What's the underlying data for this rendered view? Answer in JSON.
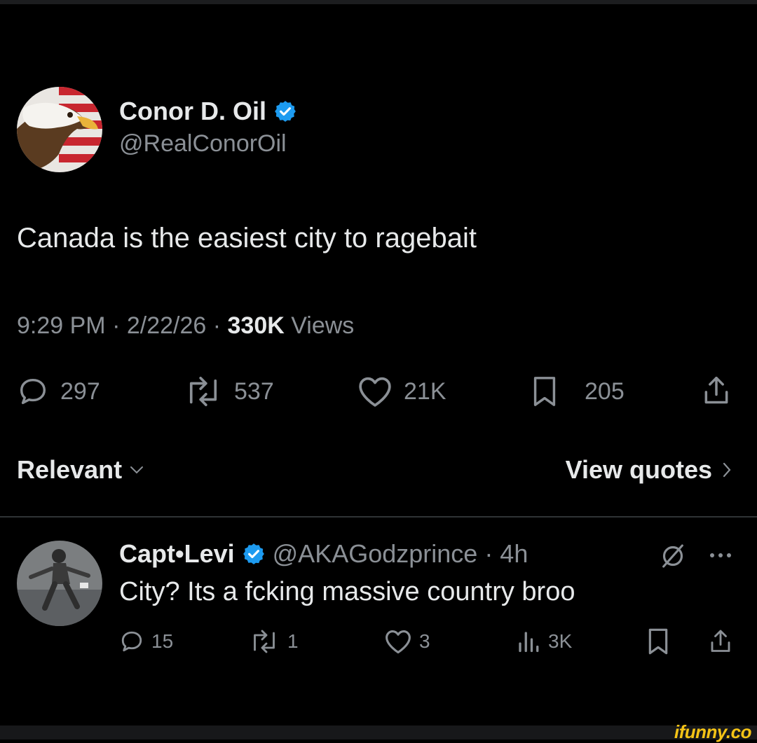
{
  "tweet": {
    "author": {
      "name": "Conor D. Oil",
      "handle": "@RealConorOil",
      "avatar_icon": "bald-eagle-flag-avatar"
    },
    "text": "Canada is the easiest city to ragebait",
    "time": "9:29 PM · 2/22/26 · ",
    "views_count": "330K",
    "views_label": " Views",
    "stats": {
      "replies": "297",
      "reposts": "537",
      "likes": "21K",
      "bookmarks": "205"
    }
  },
  "replies_bar": {
    "sort_label": "Relevant",
    "quotes_label": "View quotes"
  },
  "reply": {
    "name": "Capt•Levi",
    "handle": "@AKAGodzprince · 4h",
    "text": "City? Its a fcking massive country broo",
    "stats": {
      "replies": "15",
      "reposts": "1",
      "likes": "3",
      "views": "3K"
    }
  },
  "watermark": "ifunny.co",
  "colors": {
    "background": "#000000",
    "text": "#e7e9ea",
    "muted": "#8b9096",
    "verified": "#1d9bf0",
    "watermark": "#f4c316"
  }
}
